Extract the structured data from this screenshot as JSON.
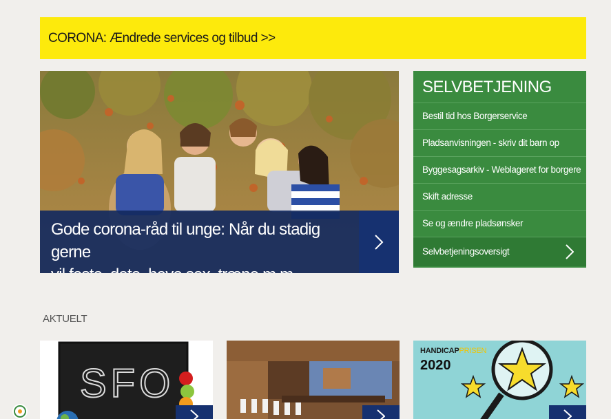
{
  "corona_banner": {
    "label": "CORONA: Ændrede services og tilbud >>"
  },
  "hero": {
    "caption_line1": "Gode corona-råd til unge: Når du stadig gerne",
    "caption_line2": "vil feste, date, have sex, træne m.m."
  },
  "selfservice": {
    "title": "SELVBETJENING",
    "items": [
      {
        "label": "Bestil tid hos Borgerservice"
      },
      {
        "label": "Pladsanvisningen - skriv dit barn op"
      },
      {
        "label": "Byggesagsarkiv - Weblageret for borgere"
      },
      {
        "label": "Skift adresse"
      },
      {
        "label": "Se og ændre pladsønsker"
      }
    ],
    "overview_label": "Selvbetjeningsoversigt"
  },
  "aktuelt": {
    "heading": "AKTUELT",
    "cards": [
      {
        "image_text": "SFO"
      },
      {
        "image_text": ""
      },
      {
        "label_bold": "HANDICAP",
        "label_accent": "PRISEN",
        "year": "2020"
      }
    ]
  },
  "colors": {
    "banner_yellow": "#fdea0c",
    "selfservice_green": "#3a8b3f",
    "navy": "#163170",
    "background": "#f1efec"
  },
  "icons": {
    "chevron": "chevron-right-icon",
    "accessibility": "accessibility-icon"
  }
}
